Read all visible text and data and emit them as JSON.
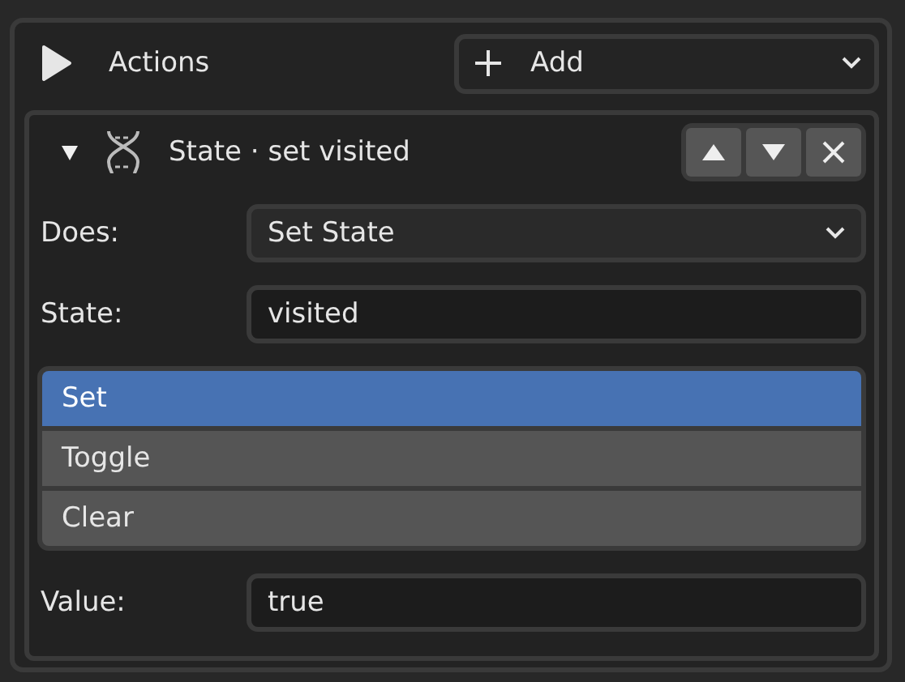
{
  "panel": {
    "title": "Actions",
    "expanded": true,
    "add_menu": {
      "label": "Add"
    }
  },
  "action": {
    "title": "State · set visited",
    "expanded": true,
    "fields": [
      {
        "kind": "dropdown",
        "label": "Does:",
        "value": "Set State"
      },
      {
        "kind": "text",
        "label": "State:",
        "value": "visited"
      },
      {
        "kind": "options",
        "items": [
          {
            "label": "Set",
            "selected": true
          },
          {
            "label": "Toggle",
            "selected": false
          },
          {
            "label": "Clear",
            "selected": false
          }
        ]
      },
      {
        "kind": "text",
        "label": "Value:",
        "value": "true"
      }
    ]
  }
}
